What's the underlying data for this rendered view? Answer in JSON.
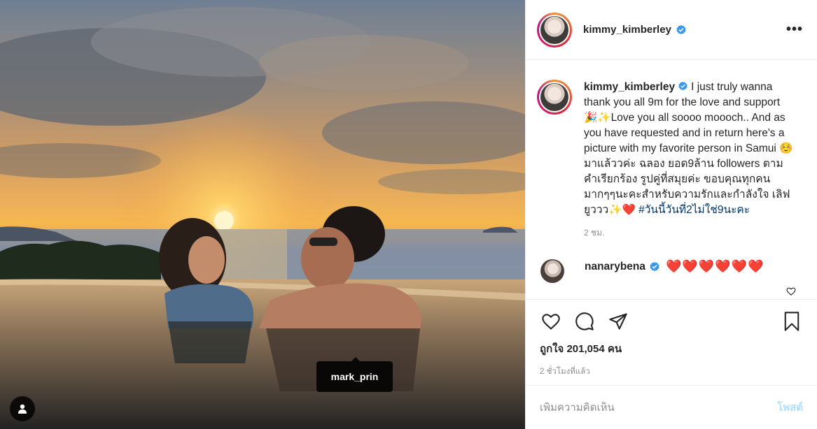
{
  "post": {
    "author": "kimmy_kimberley",
    "verified": true,
    "more_icon": "more-horizontal-icon",
    "photo_tag": "mark_prin"
  },
  "caption": {
    "username": "kimmy_kimberley",
    "text": "I just truly wanna thank you all 9m for the love and support 🎉✨Love you all soooo moooch.. And as you have requested and in return here's a picture with my favorite person in Samui ☺️ มาแล้ววค่ะ ฉลอง ยอด9ล้าน followers ตามคำเรียกร้อง รูปคู่ที่สมุยค่ะ ขอบคุณทุกคนมากๆๆนะคะสำหรับความรักและกำลังใจ เลิฟยูววว✨❤️",
    "hashtag": "#วันนี้วันที่2ไม่ใช่9นะคะ",
    "time_ago": "2 ชม."
  },
  "comment": {
    "username": "nanarybena",
    "text": "❤️❤️❤️❤️❤️❤️"
  },
  "stats": {
    "likes": "ถูกใจ 201,054 คน",
    "date": "2 ชั่วโมงที่แล้ว"
  },
  "composer": {
    "placeholder": "เพิ่มความคิดเห็น",
    "post_label": "โพสต์"
  },
  "colors": {
    "link": "#00376b",
    "verified": "#3897f0",
    "post_disabled": "#b2dffc"
  }
}
